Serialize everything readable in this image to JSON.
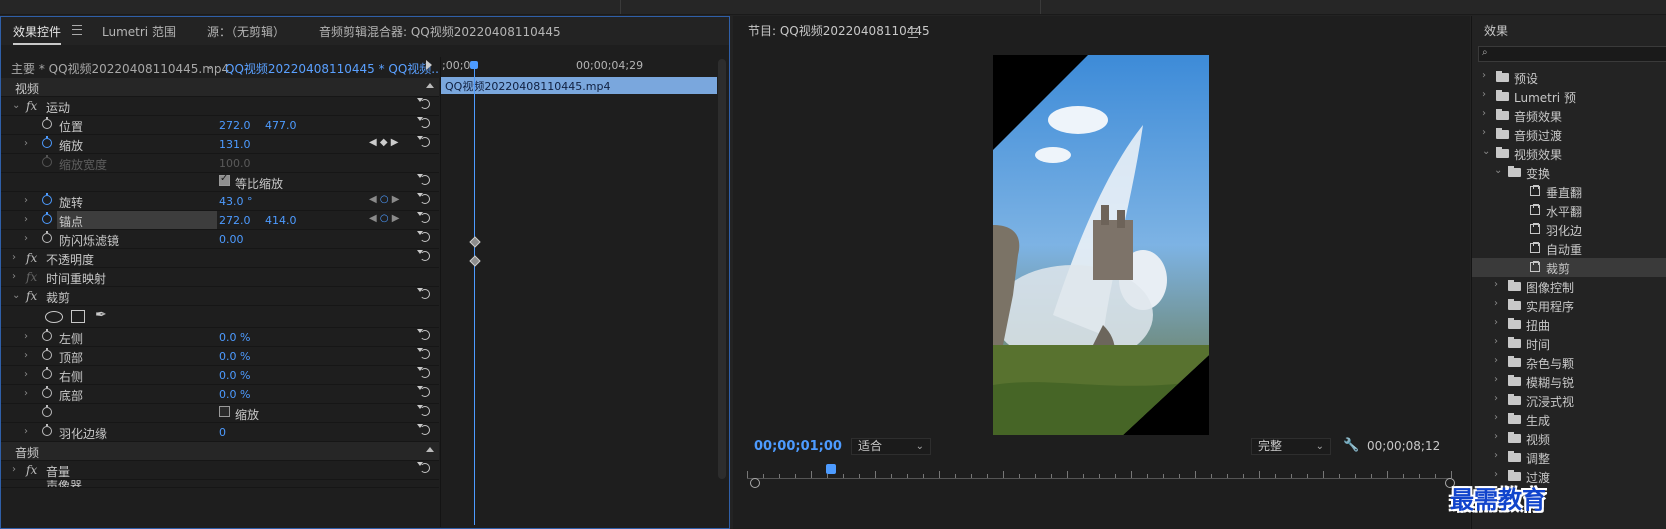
{
  "effect_controls": {
    "tabs": [
      "效果控件",
      "Lumetri 范围",
      "源：（无剪辑）",
      "音频剪辑混合器: QQ视频20220408110445"
    ],
    "master_clip": "主要 * QQ视频20220408110445.mp4",
    "sequence_clip": "QQ视频20220408110445 * QQ视频...",
    "timeline": {
      "start": ";00;00",
      "end": "00;00;04;29",
      "clip_name": "QQ视频20220408110445.mp4"
    },
    "sections": {
      "video": "视频",
      "audio": "音频"
    },
    "motion": {
      "name": "运动",
      "position": {
        "label": "位置",
        "x": "272.0",
        "y": "477.0"
      },
      "scale": {
        "label": "缩放",
        "value": "131.0"
      },
      "scale_width": {
        "label": "缩放宽度",
        "value": "100.0"
      },
      "uniform_scale": "等比缩放",
      "rotation": {
        "label": "旋转",
        "value": "43.0 °"
      },
      "anchor": {
        "label": "锚点",
        "x": "272.0",
        "y": "414.0"
      },
      "anti_flicker": {
        "label": "防闪烁滤镜",
        "value": "0.00"
      }
    },
    "opacity": "不透明度",
    "time_remap": "时间重映射",
    "crop": {
      "name": "裁剪",
      "left": {
        "label": "左侧",
        "value": "0.0 %"
      },
      "top": {
        "label": "顶部",
        "value": "0.0 %"
      },
      "right": {
        "label": "右侧",
        "value": "0.0 %"
      },
      "bottom": {
        "label": "底部",
        "value": "0.0 %"
      },
      "zoom": "缩放",
      "feather": {
        "label": "羽化边缘",
        "value": "0"
      }
    },
    "volume": "音量",
    "panner": "声像器"
  },
  "program_monitor": {
    "title": "节目: QQ视频20220408110445",
    "timecode": "00;00;01;00",
    "fit": "适合",
    "quality": "完整",
    "duration": "00;00;08;12",
    "playhead_fraction": 0.12
  },
  "effects_panel": {
    "title": "效果",
    "items": [
      {
        "label": "预设",
        "indent": 0,
        "type": "folder-star"
      },
      {
        "label": "Lumetri 预",
        "indent": 0,
        "type": "folder-star"
      },
      {
        "label": "音频效果",
        "indent": 0,
        "type": "folder"
      },
      {
        "label": "音频过渡",
        "indent": 0,
        "type": "folder"
      },
      {
        "label": "视频效果",
        "indent": 0,
        "type": "folder",
        "open": true
      },
      {
        "label": "变换",
        "indent": 1,
        "type": "folder",
        "open": true
      },
      {
        "label": "垂直翻",
        "indent": 2,
        "type": "effect"
      },
      {
        "label": "水平翻",
        "indent": 2,
        "type": "effect"
      },
      {
        "label": "羽化边",
        "indent": 2,
        "type": "effect"
      },
      {
        "label": "自动重",
        "indent": 2,
        "type": "effect"
      },
      {
        "label": "裁剪",
        "indent": 2,
        "type": "effect",
        "selected": true
      },
      {
        "label": "图像控制",
        "indent": 1,
        "type": "folder"
      },
      {
        "label": "实用程序",
        "indent": 1,
        "type": "folder"
      },
      {
        "label": "扭曲",
        "indent": 1,
        "type": "folder"
      },
      {
        "label": "时间",
        "indent": 1,
        "type": "folder"
      },
      {
        "label": "杂色与颗",
        "indent": 1,
        "type": "folder"
      },
      {
        "label": "模糊与锐",
        "indent": 1,
        "type": "folder"
      },
      {
        "label": "沉浸式视",
        "indent": 1,
        "type": "folder"
      },
      {
        "label": "生成",
        "indent": 1,
        "type": "folder"
      },
      {
        "label": "视频",
        "indent": 1,
        "type": "folder"
      },
      {
        "label": "调整",
        "indent": 1,
        "type": "folder"
      },
      {
        "label": "过渡",
        "indent": 1,
        "type": "folder"
      }
    ]
  },
  "watermark": "最需教育"
}
